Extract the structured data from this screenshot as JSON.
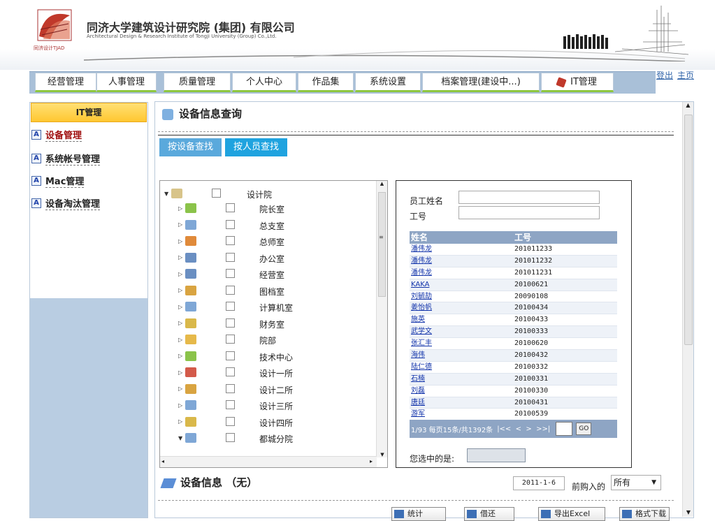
{
  "header": {
    "org_cn": "同济大学建筑设计研究院 (集团) 有限公司",
    "org_en": "Architectural Design & Research Institute of Tongji University (Group) Co.,Ltd.",
    "logo_text": "同济设计TJAD",
    "logout": "登出",
    "home": "主页"
  },
  "nav": {
    "tabs": [
      "经营管理",
      "人事管理",
      "质量管理",
      "个人中心",
      "作品集",
      "系统设置",
      "档案管理(建设中...)",
      "IT管理"
    ],
    "active_index": 7
  },
  "sidebar": {
    "title": "IT管理",
    "items": [
      "设备管理",
      "系统帐号管理",
      "Mac管理",
      "设备淘汰管理"
    ]
  },
  "main": {
    "title": "设备信息查询",
    "search_tabs": [
      "按设备查找",
      "按人员查找"
    ],
    "tree": {
      "root": "设计院",
      "children": [
        "院长室",
        "总支室",
        "总师室",
        "办公室",
        "经营室",
        "图档室",
        "计算机室",
        "财务室",
        "院部",
        "技术中心",
        "设计一所",
        "设计二所",
        "设计三所",
        "设计四所",
        "都城分院"
      ]
    },
    "employee": {
      "name_label": "员工姓名",
      "id_label": "工号",
      "col_name": "姓名",
      "col_id": "工号",
      "rows": [
        [
          "潘伟龙",
          "201011233"
        ],
        [
          "潘伟龙",
          "201011232"
        ],
        [
          "潘伟龙",
          "201011231"
        ],
        [
          "KAKA",
          "20100621"
        ],
        [
          "刘毓劼",
          "20090108"
        ],
        [
          "姜怡帆",
          "20100434"
        ],
        [
          "施英",
          "20100433"
        ],
        [
          "武学文",
          "20100333"
        ],
        [
          "张汇丰",
          "20100620"
        ],
        [
          "海伟",
          "20100432"
        ],
        [
          "陆仁德",
          "20100332"
        ],
        [
          "石楠",
          "20100331"
        ],
        [
          "刘磊",
          "20100330"
        ],
        [
          "唐廷",
          "20100431"
        ],
        [
          "游军",
          "20100539"
        ]
      ],
      "pager_text": "1/93 每页15条/共1392条",
      "pager_nav": "|<<  <  >  >>|",
      "go": "GO",
      "selected_label": "您选中的是:"
    },
    "info": {
      "title": "设备信息 （无）",
      "date": "2011-1-6",
      "date_suffix": "前购入的",
      "filter": "所有",
      "buttons": [
        "统计",
        "借还",
        "导出Excel",
        "格式下载"
      ]
    }
  },
  "colors": {
    "nav_bg": "#a9c0d8",
    "tab_underline": "#8dc63f",
    "sidebar_head": "#ffc731",
    "search_tab": "#29a8e0",
    "table_header": "#8ea5c4"
  }
}
